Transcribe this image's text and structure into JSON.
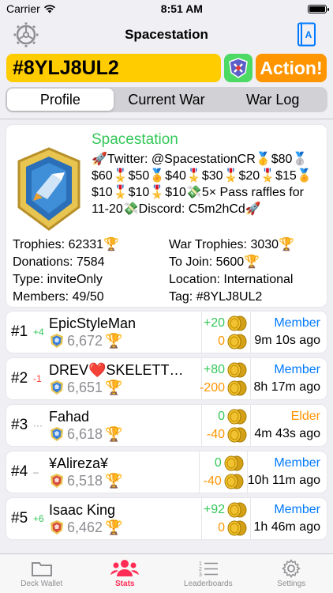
{
  "status": {
    "carrier": "Carrier",
    "time": "8:51 AM"
  },
  "nav": {
    "title": "Spacestation"
  },
  "search": {
    "tag": "#8YLJ8UL2",
    "action_label": "Action!"
  },
  "segments": [
    "Profile",
    "Current War",
    "War Log"
  ],
  "clan": {
    "name": "Spacestation",
    "description": "🚀Twitter: @SpacestationCR🥇$80🥈$60🎖️$50🏅$40🎖️$30🎖️$20🎖️$15🏅$10🎖️$10🎖️$10💸5× Pass raffles for 11-20💸Discord: C5m2hCd🚀",
    "stats": {
      "trophies_label": "Trophies:",
      "trophies": "62331",
      "war_trophies_label": "War Trophies:",
      "war_trophies": "3030",
      "donations_label": "Donations:",
      "donations": "7584",
      "to_join_label": "To Join:",
      "to_join": "5600",
      "type_label": "Type:",
      "type": "inviteOnly",
      "location_label": "Location:",
      "location": "International",
      "members_label": "Members:",
      "members": "49/50",
      "tag_label": "Tag:",
      "tag": "#8YLJ8UL2"
    }
  },
  "members": [
    {
      "rank": "#1",
      "change": "+4",
      "dir": "up",
      "name": "EpicStyleMan",
      "trophies": "6,672",
      "donated": "+20",
      "received": "0",
      "role": "Member",
      "last_seen": "9m 10s ago",
      "arena": "blue"
    },
    {
      "rank": "#2",
      "change": "-1",
      "dir": "down",
      "name": "DREV❤️SKELETT…",
      "trophies": "6,651",
      "donated": "+80",
      "received": "-200",
      "role": "Member",
      "last_seen": "8h 17m ago",
      "arena": "blue"
    },
    {
      "rank": "#3",
      "change": "···",
      "dir": "same",
      "name": "Fahad",
      "trophies": "6,618",
      "donated": "0",
      "received": "-40",
      "role": "Elder",
      "last_seen": "4m 43s ago",
      "arena": "blue"
    },
    {
      "rank": "#4",
      "change": "–",
      "dir": "same",
      "name": "¥Alireza¥",
      "trophies": "6,518",
      "donated": "0",
      "received": "-40",
      "role": "Member",
      "last_seen": "10h 11m ago",
      "arena": "red"
    },
    {
      "rank": "#5",
      "change": "+6",
      "dir": "up",
      "name": "Isaac King",
      "trophies": "6,462",
      "donated": "+92",
      "received": "0",
      "role": "Member",
      "last_seen": "1h 46m ago",
      "arena": "red"
    }
  ],
  "tabs": [
    "Deck Wallet",
    "Stats",
    "Leaderboards",
    "Settings"
  ],
  "colors": {
    "accent": "#ff2d55",
    "tag_bg": "#ffcc00",
    "action_bg": "#ff9500",
    "clan_name": "#34c759",
    "member_role": "#007aff",
    "elder_role": "#ff9500"
  }
}
